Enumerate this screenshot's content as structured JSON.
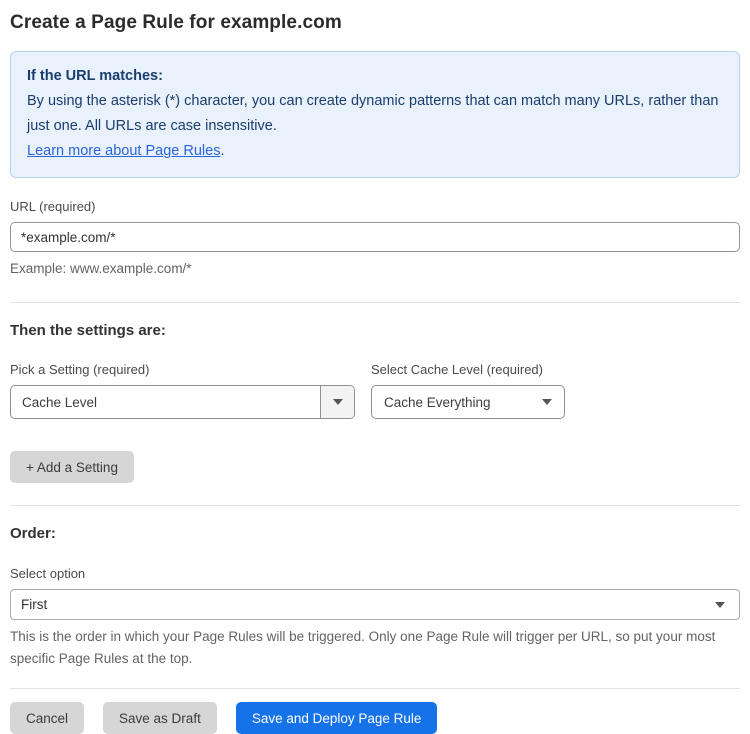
{
  "page": {
    "title": "Create a Page Rule for example.com"
  },
  "info_box": {
    "heading": "If the URL matches:",
    "body": "By using the asterisk (*) character, you can create dynamic patterns that can match many URLs, rather than just one. All URLs are case insensitive.",
    "link_label": "Learn more about Page Rules",
    "link_suffix": "."
  },
  "url_field": {
    "label": "URL (required)",
    "value": "*example.com/*",
    "helper": "Example: www.example.com/*"
  },
  "settings_section": {
    "heading": "Then the settings are:",
    "setting_picker": {
      "label": "Pick a Setting (required)",
      "value": "Cache Level"
    },
    "cache_level_picker": {
      "label": "Select Cache Level (required)",
      "value": "Cache Everything"
    },
    "add_setting_label": "+ Add a Setting"
  },
  "order_section": {
    "heading": "Order:",
    "select_label": "Select option",
    "value": "First",
    "helper": "This is the order in which your Page Rules will be triggered. Only one Page Rule will trigger per URL, so put your most specific Page Rules at the top."
  },
  "actions": {
    "cancel": "Cancel",
    "save_draft": "Save as Draft",
    "save_deploy": "Save and Deploy Page Rule"
  },
  "colors": {
    "primary_blue": "#1672e8",
    "info_bg": "#e8f1fc",
    "info_border": "#b5d3f0",
    "info_text": "#1b3d6d",
    "link_blue": "#2c64d9",
    "button_gray": "#d6d6d6"
  },
  "icons": {
    "dropdown_arrow": "triangle-down"
  }
}
